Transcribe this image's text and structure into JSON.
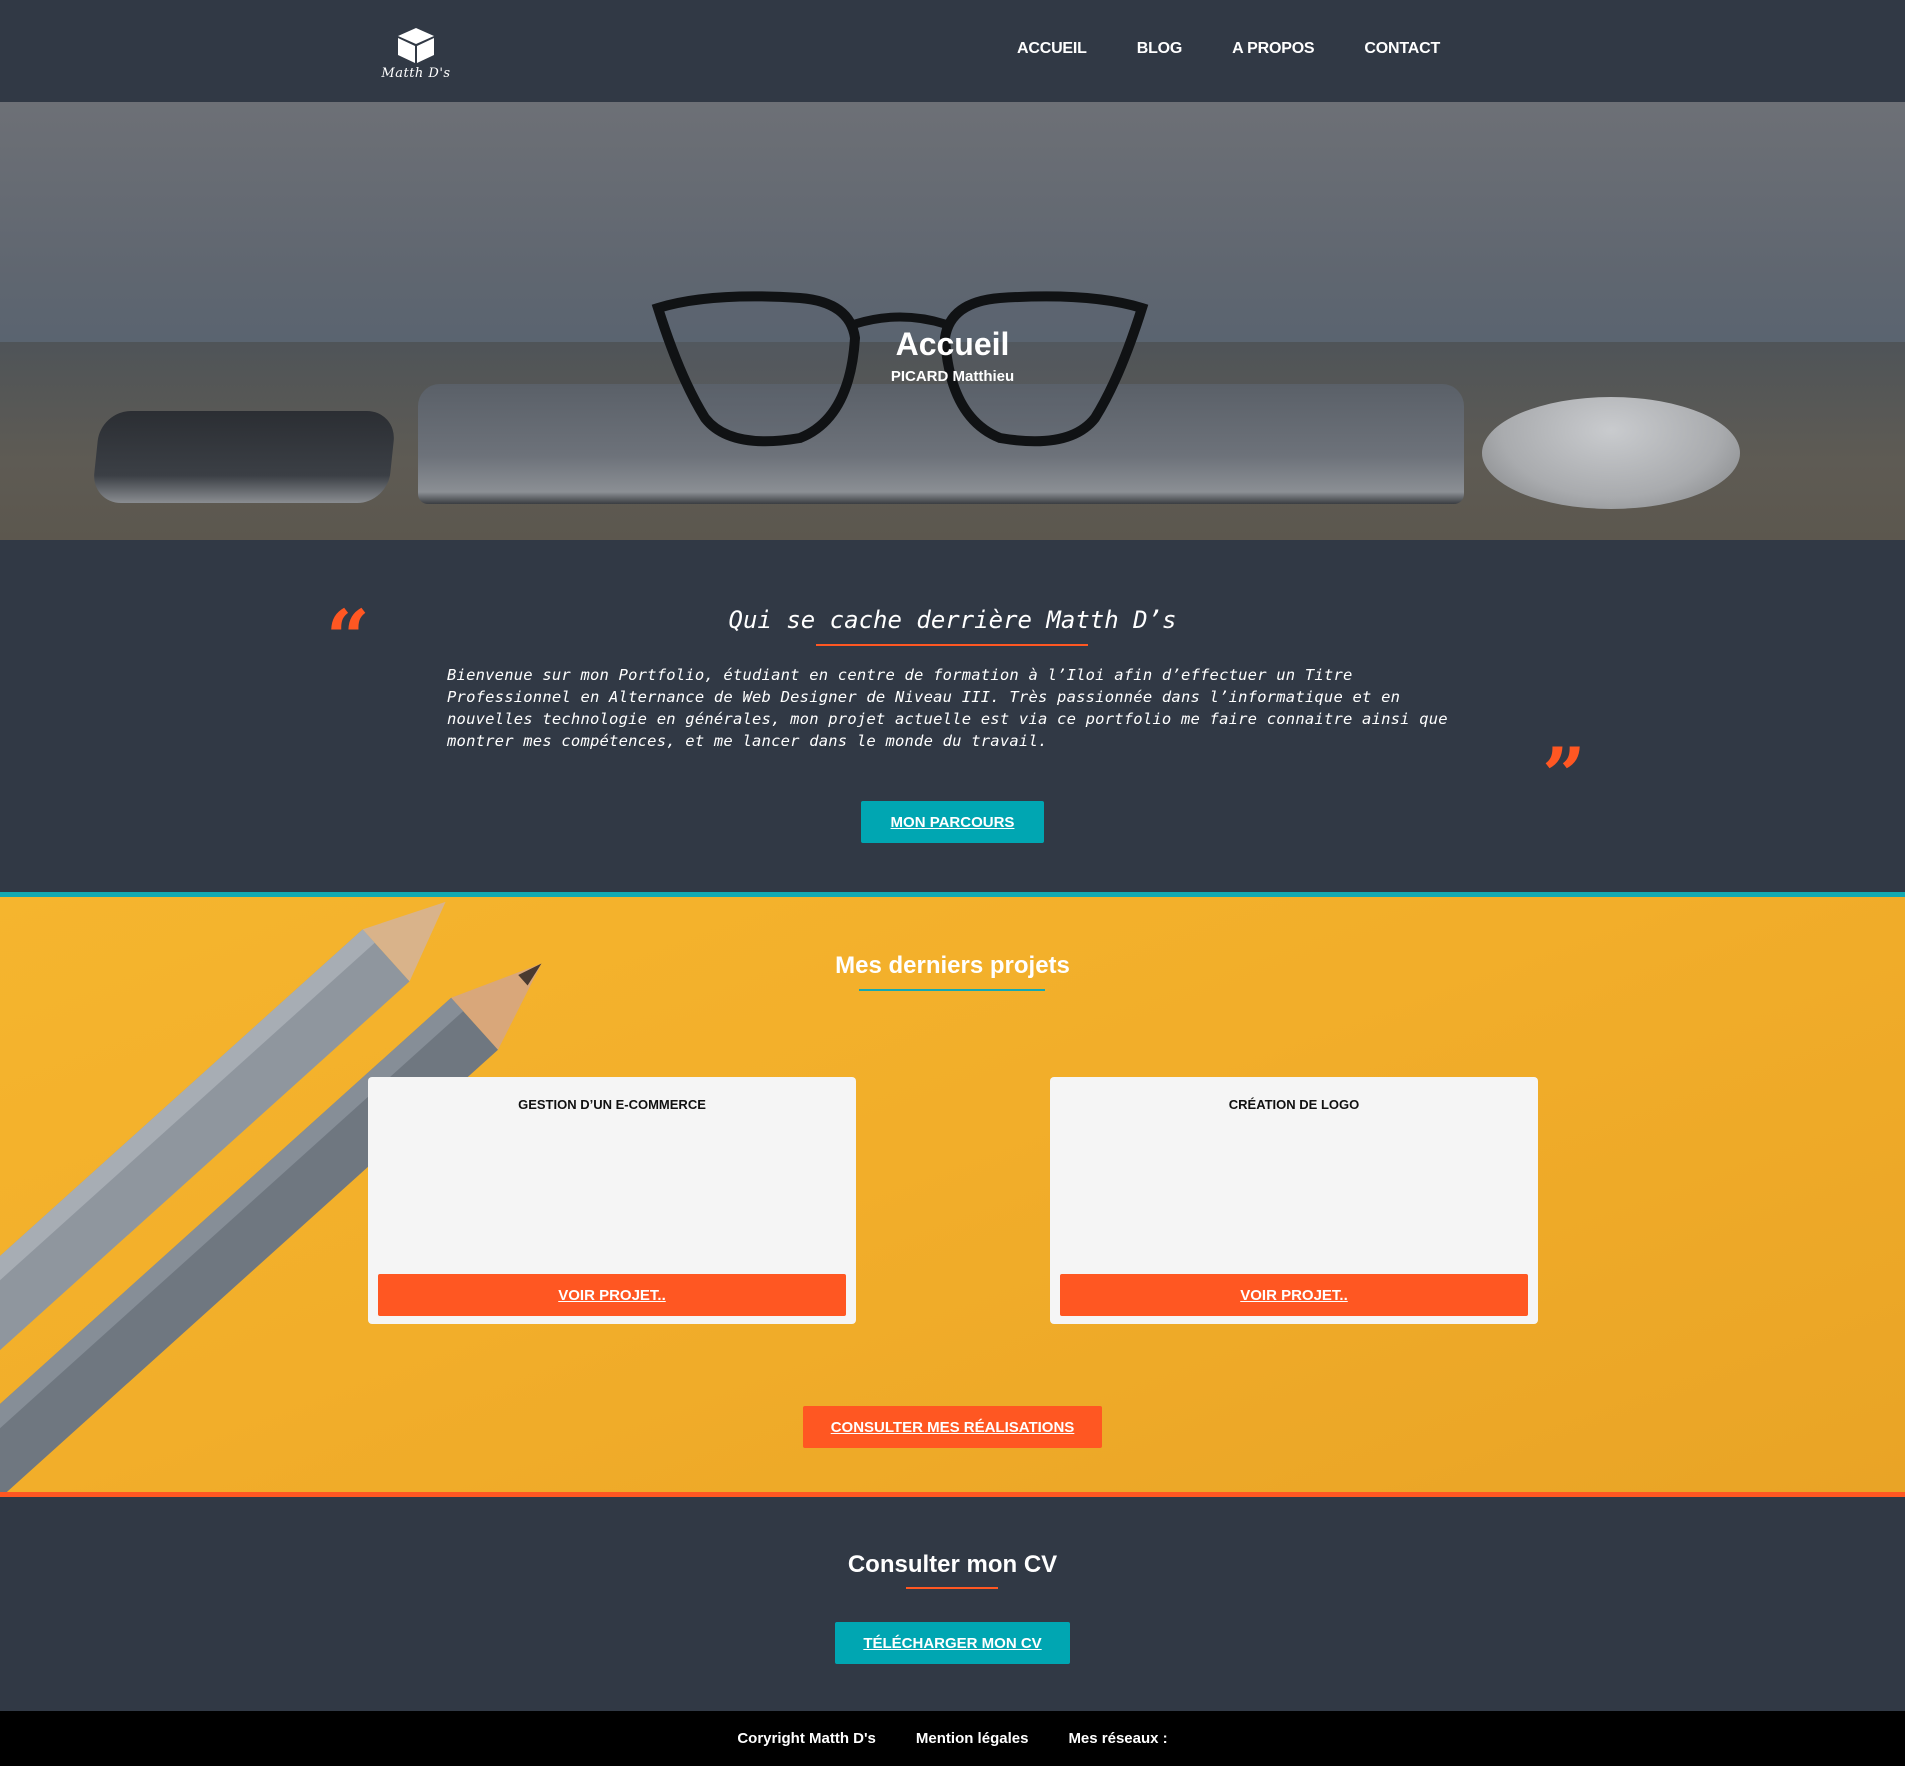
{
  "header": {
    "logo_text": "Matth D's",
    "nav": [
      "ACCUEIL",
      "BLOG",
      "A PROPOS",
      "CONTACT"
    ]
  },
  "hero": {
    "title": "Accueil",
    "subtitle": "PICARD Matthieu"
  },
  "about": {
    "quote_open": "“",
    "quote_close": "”",
    "title": "Qui se cache derrière Matth D’s",
    "text": "Bienvenue sur mon Portfolio, étudiant en centre de formation à l’Iloi afin d’effectuer un Titre Professionnel en Alternance de Web Designer de Niveau III. Très passionnée dans l’informatique et en nouvelles technologie en générales, mon projet actuelle est via ce portfolio me faire connaitre ainsi que montrer mes compétences, et me lancer dans le monde du travail.",
    "button": "MON PARCOURS"
  },
  "projects": {
    "title": "Mes derniers projets",
    "items": [
      {
        "title": "GESTION D’UN E-COMMERCE",
        "button": "VOIR PROJET.."
      },
      {
        "title": "CRÉATION DE LOGO",
        "button": "VOIR PROJET.."
      }
    ],
    "button": "CONSULTER MES RÉALISATIONS"
  },
  "cv": {
    "title": "Consulter mon CV",
    "button": "TÉLÉCHARGER MON CV"
  },
  "footer": {
    "copyright": "Coryright Matth D's",
    "legal": "Mention légales",
    "social": "Mes réseaux :"
  },
  "colors": {
    "dark": "#313945",
    "teal": "#00a6b2",
    "orange": "#ff5722",
    "yellow": "#f5b52e"
  }
}
